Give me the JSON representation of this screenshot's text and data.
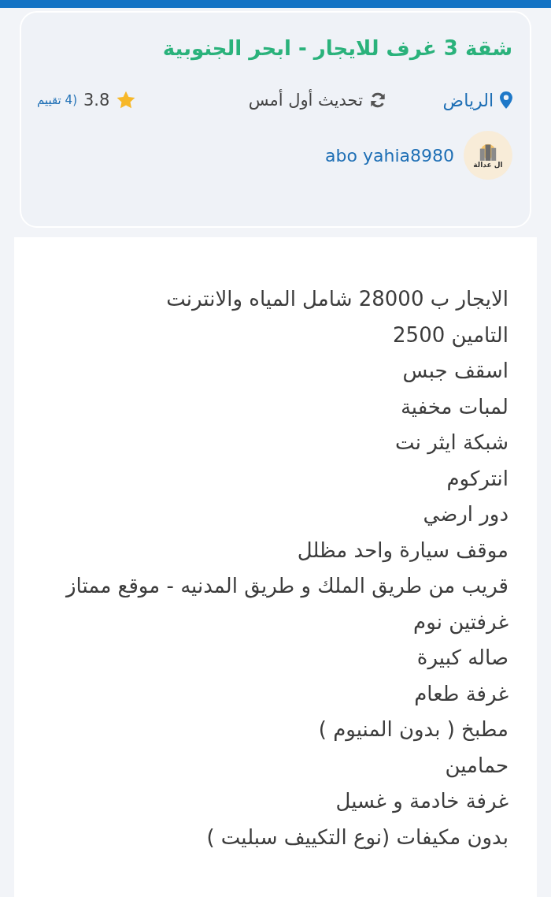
{
  "listing": {
    "title": "شقة 3 غرف للايجار - ابحر الجنوبية",
    "city": "الرياض",
    "updated": "تحديث أول أمس",
    "rating": "3.8",
    "rating_count": "(4 تقييم",
    "seller": {
      "name": "abo yahia8980",
      "logo_text": "ال عدالة"
    }
  },
  "description": [
    "الايجار ب 28000 شامل المياه والانترنت",
    "التامين 2500",
    "اسقف جبس",
    "لمبات مخفية",
    "شبكة ايثر نت",
    "انتركوم",
    "دور ارضي",
    "موقف سيارة واحد مظلل",
    " قريب من طريق الملك و طريق المدنيه  -  موقع ممتاز",
    "غرفتين نوم",
    "صاله كبيرة",
    "غرفة طعام",
    "مطبخ ( بدون المنيوم )",
    "حمامين",
    "غرفة خادمة و غسيل",
    "بدون مكيفات (نوع التكييف سبليت )"
  ]
}
